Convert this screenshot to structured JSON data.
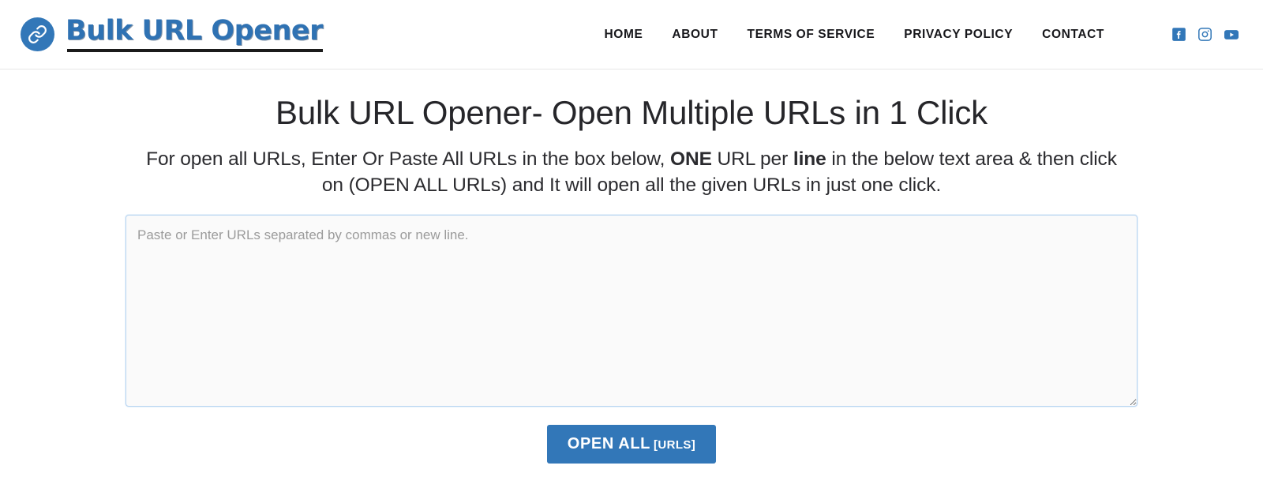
{
  "header": {
    "brand": {
      "icon": "link-chain-icon",
      "text": "Bulk URL Opener",
      "accent_color": "#3277b8"
    },
    "nav": [
      {
        "label": "HOME",
        "name": "nav-link-home"
      },
      {
        "label": "ABOUT",
        "name": "nav-link-about"
      },
      {
        "label": "TERMS OF SERVICE",
        "name": "nav-link-terms-of-service"
      },
      {
        "label": "PRIVACY POLICY",
        "name": "nav-link-privacy-policy"
      },
      {
        "label": "CONTACT",
        "name": "nav-link-contact"
      }
    ],
    "social": [
      {
        "icon": "facebook-icon",
        "color": "#3277b8"
      },
      {
        "icon": "instagram-icon",
        "color": "#3277b8"
      },
      {
        "icon": "youtube-icon",
        "color": "#3277b8"
      }
    ]
  },
  "main": {
    "title": "Bulk URL Opener- Open Multiple URLs in 1 Click",
    "intro": {
      "part1": "For open all URLs, Enter Or Paste All URLs in the box below, ",
      "bold1": "ONE",
      "part2": " URL per ",
      "bold2": "line",
      "part3": " in the below text area & then click on (OPEN ALL URLs) and It will open all the given URLs in just one click."
    },
    "textarea": {
      "placeholder": "Paste or Enter URLs separated by commas or new line.",
      "value": ""
    },
    "submit": {
      "label": "OPEN ALL",
      "sublabel": "[URLS]",
      "color": "#3277b8"
    }
  }
}
